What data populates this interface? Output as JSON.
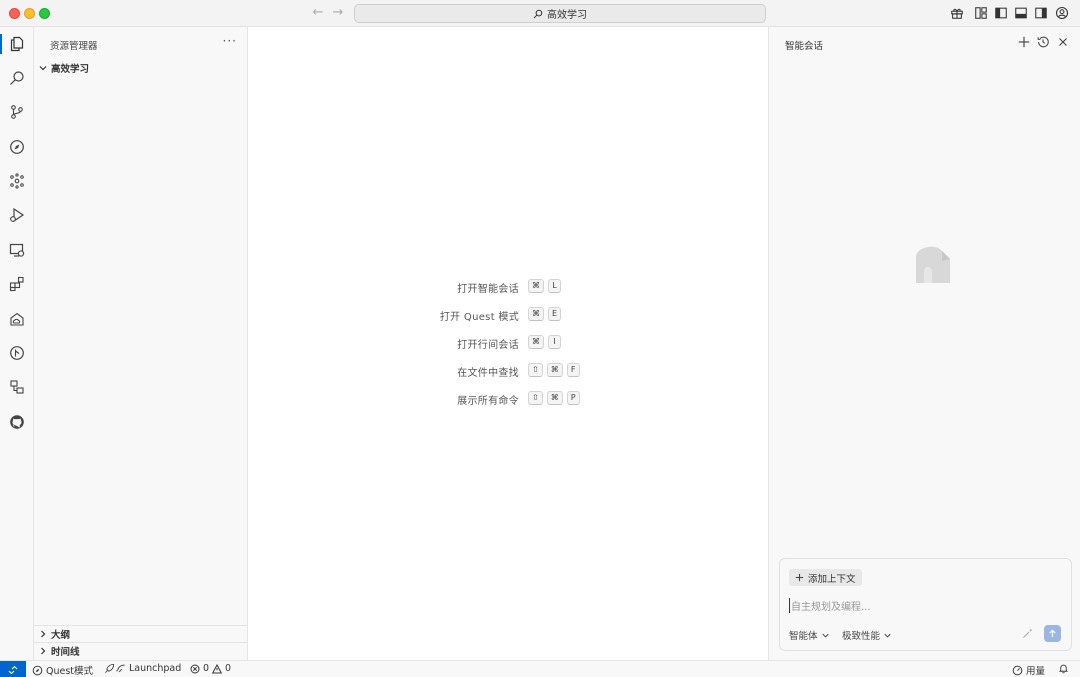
{
  "titlebar": {
    "search_text": "高效学习"
  },
  "sidebar": {
    "header": "资源管理器",
    "more": "···",
    "folder": "高效学习",
    "sections": [
      "大纲",
      "时间线"
    ]
  },
  "activity_icons": [
    "explorer-icon",
    "search-icon",
    "source-control-icon",
    "compass-icon",
    "graph-icon",
    "run-debug-icon",
    "remote-explorer-icon",
    "extensions-icon",
    "cloud-deploy-icon",
    "git-branch-icon",
    "flow-icon",
    "github-icon"
  ],
  "editor": {
    "shortcuts": [
      {
        "label": "打开智能会话",
        "keys": [
          "⌘",
          "L"
        ]
      },
      {
        "label": "打开 Quest 模式",
        "keys": [
          "⌘",
          "E"
        ]
      },
      {
        "label": "打开行间会话",
        "keys": [
          "⌘",
          "I"
        ]
      },
      {
        "label": "在文件中查找",
        "keys": [
          "⇧",
          "⌘",
          "F"
        ]
      },
      {
        "label": "展示所有命令",
        "keys": [
          "⇧",
          "⌘",
          "P"
        ]
      }
    ]
  },
  "chat": {
    "title": "智能会话",
    "add_context": "添加上下文",
    "input_placeholder": "自主规划及编程...",
    "agent_mode": "智能体",
    "performance_mode": "极致性能"
  },
  "statusbar": {
    "quest": "Quest模式",
    "launchpad": "Launchpad",
    "errors": "0",
    "warnings": "0",
    "usage": "用量"
  },
  "colors": {
    "accent": "#0066cc",
    "send": "#9bb5e4"
  }
}
